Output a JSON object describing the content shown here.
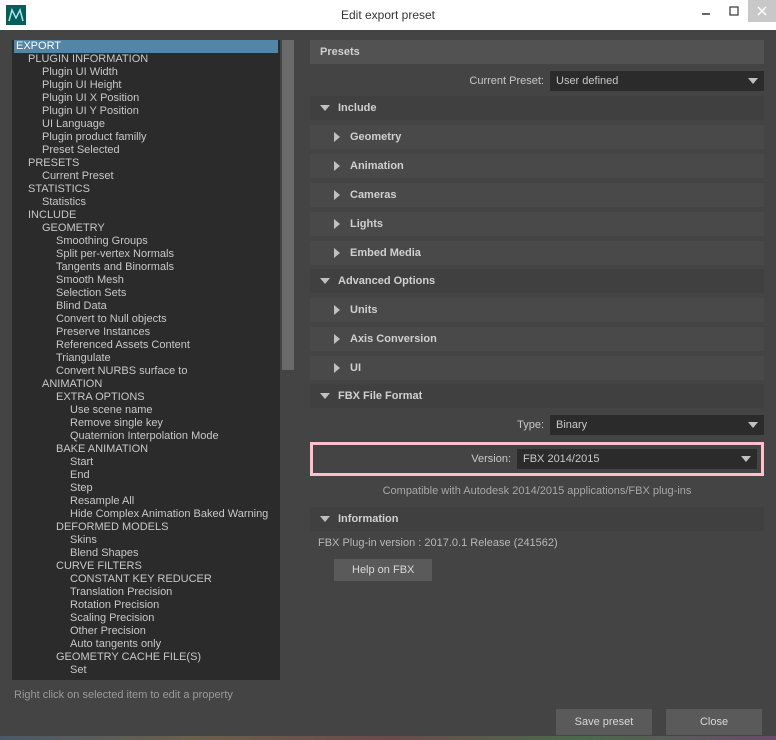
{
  "window": {
    "title": "Edit export preset"
  },
  "tree": [
    {
      "label": "EXPORT",
      "lvl": 0,
      "selected": true
    },
    {
      "label": "PLUGIN INFORMATION",
      "lvl": 1
    },
    {
      "label": "Plugin UI Width",
      "lvl": 2
    },
    {
      "label": "Plugin UI Height",
      "lvl": 2
    },
    {
      "label": "Plugin UI X Position",
      "lvl": 2
    },
    {
      "label": "Plugin UI Y Position",
      "lvl": 2
    },
    {
      "label": "UI Language",
      "lvl": 2
    },
    {
      "label": "Plugin product familly",
      "lvl": 2
    },
    {
      "label": "Preset Selected",
      "lvl": 2
    },
    {
      "label": "PRESETS",
      "lvl": 1
    },
    {
      "label": "Current Preset",
      "lvl": 2
    },
    {
      "label": "STATISTICS",
      "lvl": 1
    },
    {
      "label": "Statistics",
      "lvl": 2
    },
    {
      "label": "INCLUDE",
      "lvl": 1
    },
    {
      "label": "GEOMETRY",
      "lvl": 2
    },
    {
      "label": "Smoothing Groups",
      "lvl": 3
    },
    {
      "label": "Split per-vertex Normals",
      "lvl": 3
    },
    {
      "label": "Tangents and Binormals",
      "lvl": 3
    },
    {
      "label": "Smooth Mesh",
      "lvl": 3
    },
    {
      "label": "Selection Sets",
      "lvl": 3
    },
    {
      "label": "Blind Data",
      "lvl": 3
    },
    {
      "label": "Convert to Null objects",
      "lvl": 3
    },
    {
      "label": "Preserve Instances",
      "lvl": 3
    },
    {
      "label": "Referenced Assets Content",
      "lvl": 3
    },
    {
      "label": "Triangulate",
      "lvl": 3
    },
    {
      "label": "Convert NURBS surface to",
      "lvl": 3
    },
    {
      "label": "ANIMATION",
      "lvl": 2
    },
    {
      "label": "EXTRA OPTIONS",
      "lvl": 3
    },
    {
      "label": "Use scene name",
      "lvl": 4
    },
    {
      "label": "Remove single key",
      "lvl": 4
    },
    {
      "label": "Quaternion Interpolation Mode",
      "lvl": 4
    },
    {
      "label": "BAKE ANIMATION",
      "lvl": 3
    },
    {
      "label": "Start",
      "lvl": 4
    },
    {
      "label": "End",
      "lvl": 4
    },
    {
      "label": "Step",
      "lvl": 4
    },
    {
      "label": "Resample All",
      "lvl": 4
    },
    {
      "label": "Hide Complex Animation Baked Warning",
      "lvl": 4
    },
    {
      "label": "DEFORMED MODELS",
      "lvl": 3
    },
    {
      "label": "Skins",
      "lvl": 4
    },
    {
      "label": "Blend Shapes",
      "lvl": 4
    },
    {
      "label": "CURVE FILTERS",
      "lvl": 3
    },
    {
      "label": "CONSTANT KEY REDUCER",
      "lvl": 4
    },
    {
      "label": "Translation Precision",
      "lvl": 4
    },
    {
      "label": "Rotation Precision",
      "lvl": 4
    },
    {
      "label": "Scaling Precision",
      "lvl": 4
    },
    {
      "label": "Other Precision",
      "lvl": 4
    },
    {
      "label": "Auto tangents only",
      "lvl": 4
    },
    {
      "label": "GEOMETRY CACHE FILE(S)",
      "lvl": 3
    },
    {
      "label": "Set",
      "lvl": 4
    }
  ],
  "right": {
    "presets_header": "Presets",
    "current_preset_label": "Current Preset:",
    "current_preset_value": "User defined",
    "include_header": "Include",
    "geometry": "Geometry",
    "animation": "Animation",
    "cameras": "Cameras",
    "lights": "Lights",
    "embed_media": "Embed Media",
    "advanced_header": "Advanced Options",
    "units": "Units",
    "axis_conversion": "Axis Conversion",
    "ui": "UI",
    "fbx_format_header": "FBX File Format",
    "type_label": "Type:",
    "type_value": "Binary",
    "version_label": "Version:",
    "version_value": "FBX 2014/2015",
    "compat_text": "Compatible with Autodesk 2014/2015 applications/FBX plug-ins",
    "information_header": "Information",
    "plugin_version_text": "FBX Plug-in version :  2017.0.1 Release (241562)",
    "help_button": "Help on FBX"
  },
  "footer": {
    "hint": "Right click on selected item to edit a property",
    "save": "Save preset",
    "close": "Close"
  }
}
